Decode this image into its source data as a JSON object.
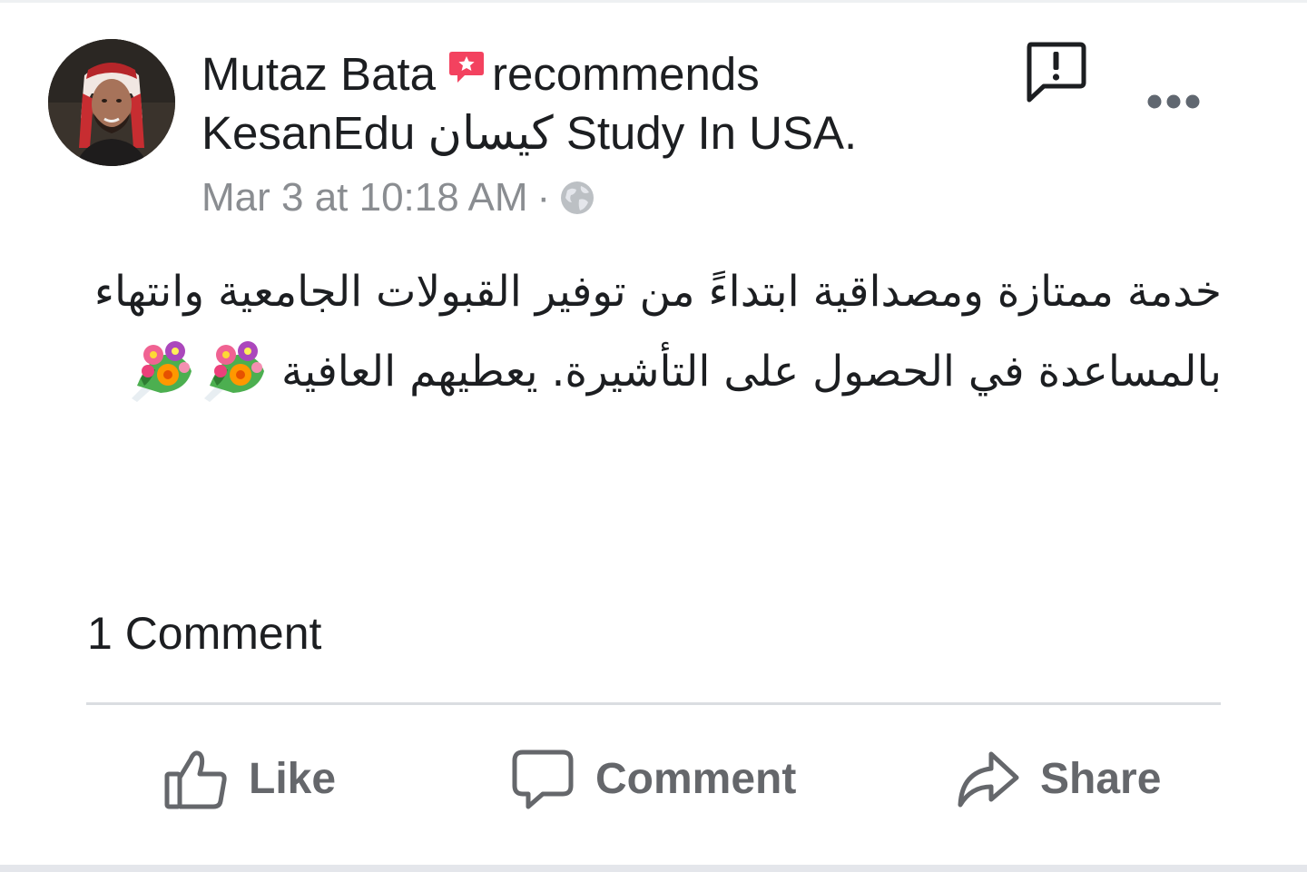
{
  "post": {
    "author_name": "Mutaz Bata",
    "action_text": "recommends",
    "page_name": "KesanEdu كيسان Study In USA.",
    "timestamp": "Mar 3 at 10:18 AM",
    "separator": "·",
    "privacy_icon": "globe-icon",
    "text": "خدمة ممتازة ومصداقية ابتداءً من توفير القبولات الجامعية وانتهاء بالمساعدة في الحصول على التأشيرة. يعطيهم العافية",
    "emoji": [
      "bouquet",
      "bouquet"
    ]
  },
  "header_actions": {
    "report_icon": "report-icon",
    "more_icon": "more-options-icon"
  },
  "stats": {
    "comment_count_label": "1 Comment"
  },
  "actions": {
    "like_label": "Like",
    "comment_label": "Comment",
    "share_label": "Share"
  },
  "colors": {
    "primary_text": "#1c1e21",
    "secondary_text": "#8a8d91",
    "action_text": "#65676b",
    "recommend_badge": "#f3425f",
    "divider": "#dadde1"
  }
}
